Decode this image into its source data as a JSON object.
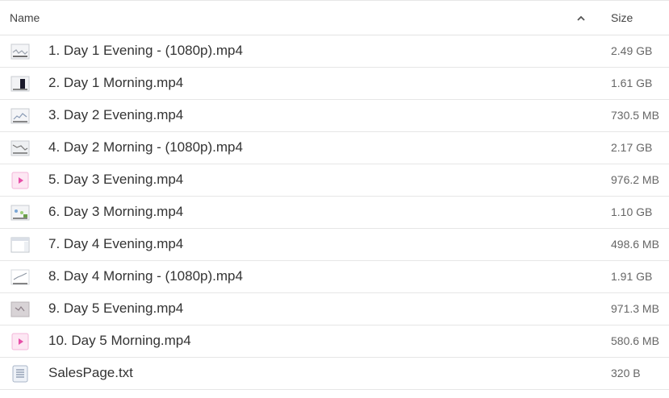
{
  "header": {
    "name_label": "Name",
    "size_label": "Size",
    "sort_icon": "chevron-up-icon"
  },
  "files": [
    {
      "name": "1. Day 1 Evening - (1080p).mp4",
      "size": "2.49 GB",
      "icon": "video-thumbnail-icon"
    },
    {
      "name": "2. Day 1 Morning.mp4",
      "size": "1.61 GB",
      "icon": "video-thumbnail-icon"
    },
    {
      "name": "3. Day 2 Evening.mp4",
      "size": "730.5 MB",
      "icon": "video-thumbnail-icon"
    },
    {
      "name": "4. Day 2 Morning - (1080p).mp4",
      "size": "2.17 GB",
      "icon": "video-thumbnail-icon"
    },
    {
      "name": "5. Day 3 Evening.mp4",
      "size": "976.2 MB",
      "icon": "video-file-icon"
    },
    {
      "name": "6. Day 3 Morning.mp4",
      "size": "1.10 GB",
      "icon": "video-thumbnail-icon"
    },
    {
      "name": "7. Day 4 Evening.mp4",
      "size": "498.6 MB",
      "icon": "video-thumbnail-icon"
    },
    {
      "name": "8. Day 4 Morning - (1080p).mp4",
      "size": "1.91 GB",
      "icon": "video-thumbnail-icon"
    },
    {
      "name": "9. Day 5 Evening.mp4",
      "size": "971.3 MB",
      "icon": "video-thumbnail-icon"
    },
    {
      "name": "10. Day 5 Morning.mp4",
      "size": "580.6 MB",
      "icon": "video-file-icon"
    },
    {
      "name": "SalesPage.txt",
      "size": "320 B",
      "icon": "text-file-icon"
    }
  ]
}
